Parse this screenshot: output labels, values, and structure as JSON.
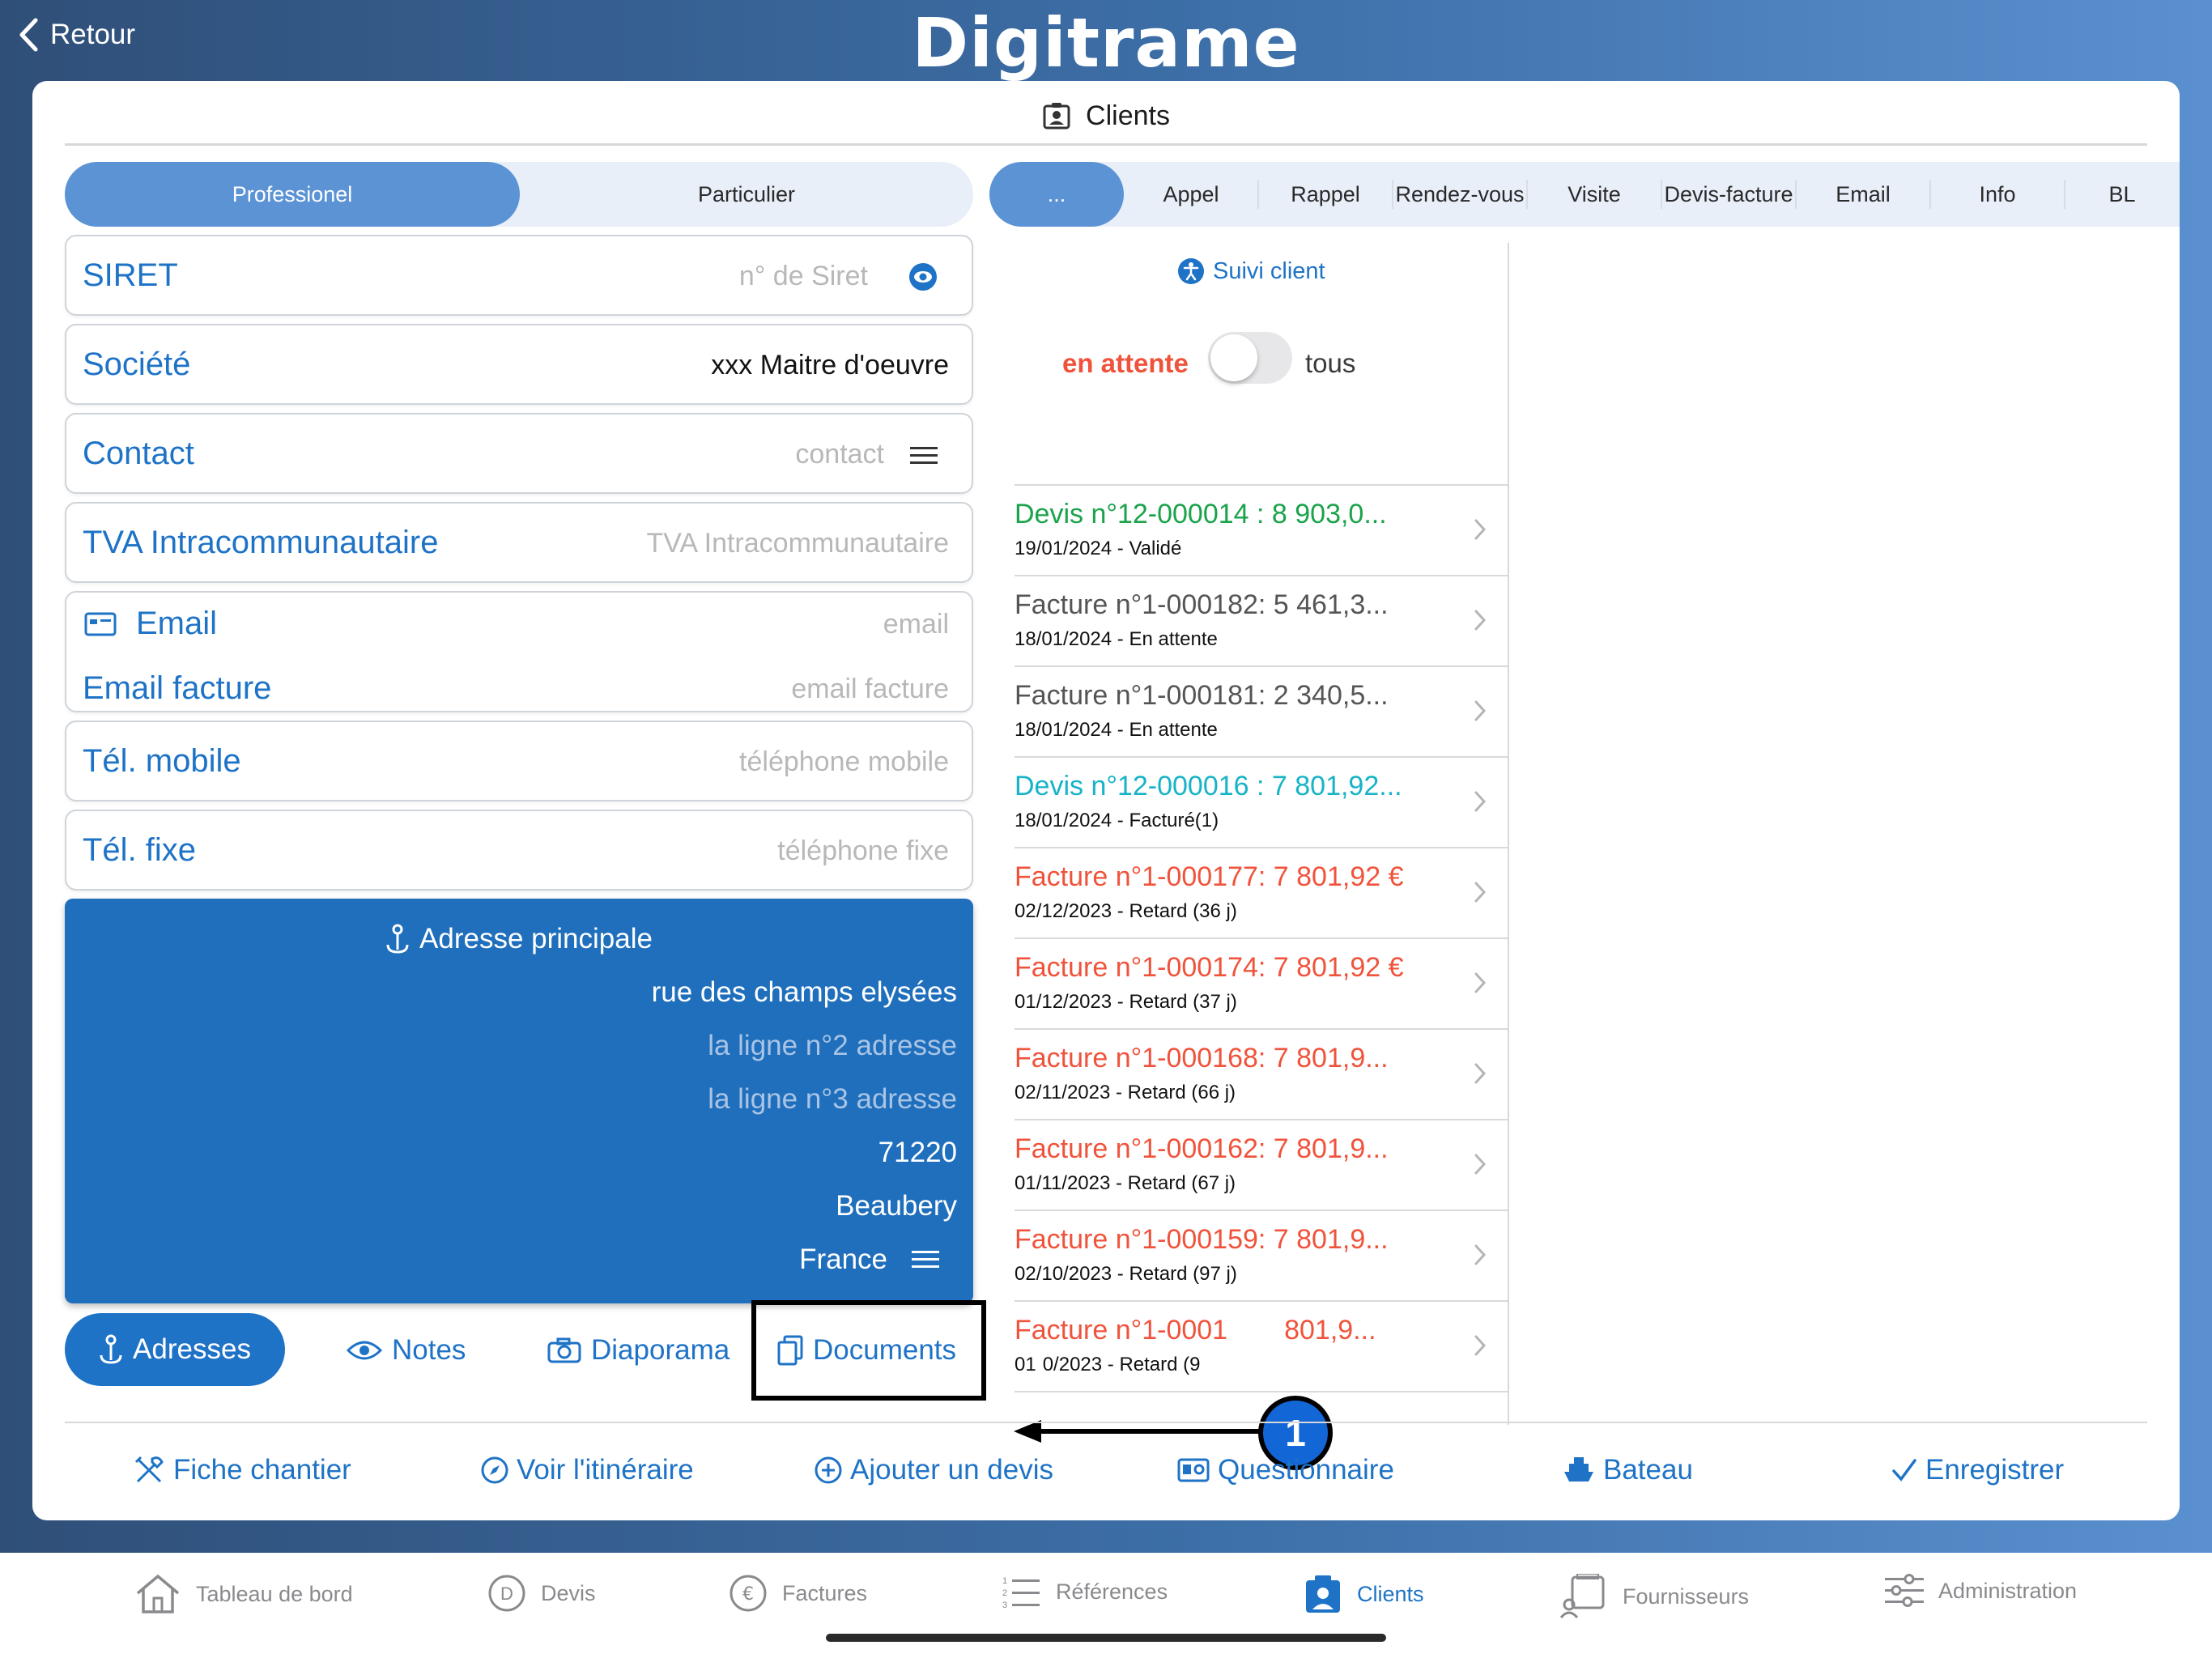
{
  "header": {
    "back_label": "Retour",
    "logo_text": "Digitrame"
  },
  "card": {
    "title": "Clients"
  },
  "client_type": {
    "options": [
      "Professionel",
      "Particulier"
    ],
    "selected": "Professionel"
  },
  "form": {
    "siret": {
      "label": "SIRET",
      "placeholder": "n° de Siret"
    },
    "societe": {
      "label": "Société",
      "value": "xxx Maitre d'oeuvre"
    },
    "contact": {
      "label": "Contact",
      "placeholder": "contact"
    },
    "tva": {
      "label": "TVA Intracommunautaire",
      "placeholder": "TVA Intracommunautaire"
    },
    "email": {
      "label": "Email",
      "placeholder": "email"
    },
    "email_facture": {
      "label": "Email facture",
      "placeholder": "email facture"
    },
    "tel_mobile": {
      "label": "Tél. mobile",
      "placeholder": "téléphone mobile"
    },
    "tel_fixe": {
      "label": "Tél. fixe",
      "placeholder": "téléphone fixe"
    }
  },
  "address": {
    "title": "Adresse principale",
    "line1": "rue des champs elysées",
    "line2": "la ligne n°2 adresse",
    "line3": "la ligne n°3 adresse",
    "postcode": "71220",
    "city": "Beaubery",
    "country": "France"
  },
  "left_tabs": {
    "adresses": "Adresses",
    "notes": "Notes",
    "diaporama": "Diaporama",
    "documents": "Documents"
  },
  "right_tabs": [
    "...",
    "Appel",
    "Rappel",
    "Rendez-vous",
    "Visite",
    "Devis-facture",
    "Email",
    "Info",
    "BL"
  ],
  "suivi": {
    "label": "Suivi client",
    "filter_left": "en attente",
    "filter_right": "tous",
    "toggle_on": false
  },
  "documents": [
    {
      "title": "Devis n°12-000014 : 8 903,0...",
      "subtitle": "19/01/2024 - Validé",
      "color": "#1aa34a"
    },
    {
      "title": "Facture n°1-000182: 5 461,3...",
      "subtitle": "18/01/2024  - En attente",
      "color": "#555555"
    },
    {
      "title": "Facture n°1-000181: 2 340,5...",
      "subtitle": "18/01/2024  - En attente",
      "color": "#555555"
    },
    {
      "title": "Devis n°12-000016 : 7 801,92...",
      "subtitle": "18/01/2024 - Facturé(1)",
      "color": "#17b3c8"
    },
    {
      "title": "Facture n°1-000177: 7 801,92 €",
      "subtitle": "02/12/2023  - Retard  (36 j)",
      "color": "#f0533b"
    },
    {
      "title": "Facture n°1-000174: 7 801,92 €",
      "subtitle": "01/12/2023  - Retard  (37 j)",
      "color": "#f0533b"
    },
    {
      "title": "Facture n°1-000168: 7 801,9...",
      "subtitle": "02/11/2023  - Retard  (66 j)",
      "color": "#f0533b"
    },
    {
      "title": "Facture n°1-000162: 7 801,9...",
      "subtitle": "01/11/2023  - Retard  (67 j)",
      "color": "#f0533b"
    },
    {
      "title": "Facture n°1-000159: 7 801,9...",
      "subtitle": "02/10/2023  - Retard  (97 j)",
      "color": "#f0533b"
    },
    {
      "title": "Facture n°1-0001",
      "title_tail": "801,9...",
      "subtitle": "01",
      "subtitle_tail": "0/2023  - Retard  (9",
      "color": "#f0533b"
    }
  ],
  "annotation": {
    "badge": "1"
  },
  "actions": [
    "Fiche chantier",
    "Voir l'itinéraire",
    "Ajouter un devis",
    "Questionnaire",
    "Bateau",
    "Enregistrer"
  ],
  "tabbar": {
    "items": [
      "Tableau de bord",
      "Devis",
      "Factures",
      "Références",
      "Clients",
      "Fournisseurs",
      "Administration"
    ],
    "active": "Clients"
  },
  "colors": {
    "accent": "#1e73c7",
    "pill_active": "#5b93d5",
    "address_bg": "#1f6fbd",
    "late": "#f0533b",
    "validated": "#1aa34a",
    "invoiced": "#17b3c8"
  }
}
